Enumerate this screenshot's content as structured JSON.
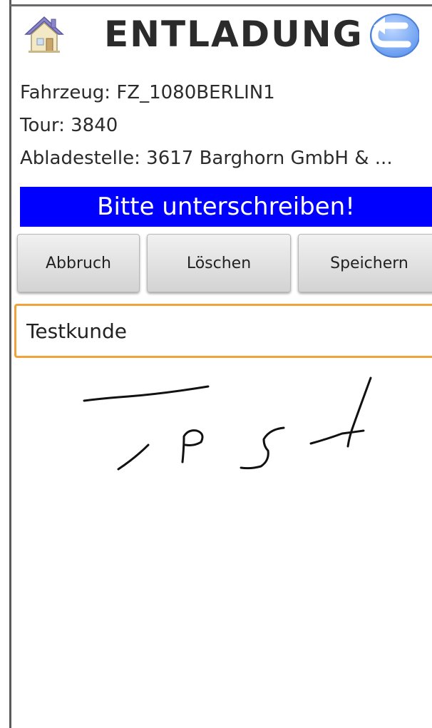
{
  "header": {
    "title": "ENTLADUNG",
    "home_icon": "home-icon",
    "back_icon": "back-arrow-icon"
  },
  "info": {
    "vehicle": "Fahrzeug: FZ_1080BERLIN1",
    "tour": "Tour: 3840",
    "unloading_point": "Abladestelle: 3617 Barghorn GmbH & ..."
  },
  "banner": {
    "text": "Bitte unterschreiben!"
  },
  "buttons": {
    "cancel": "Abbruch",
    "clear": "Löschen",
    "save": "Speichern"
  },
  "name_field": {
    "value": "Testkunde"
  },
  "colors": {
    "banner_bg": "#0000ff",
    "banner_text": "#ffffff",
    "input_focus_border": "#f2a23a",
    "title_text": "#2b2b2b"
  }
}
